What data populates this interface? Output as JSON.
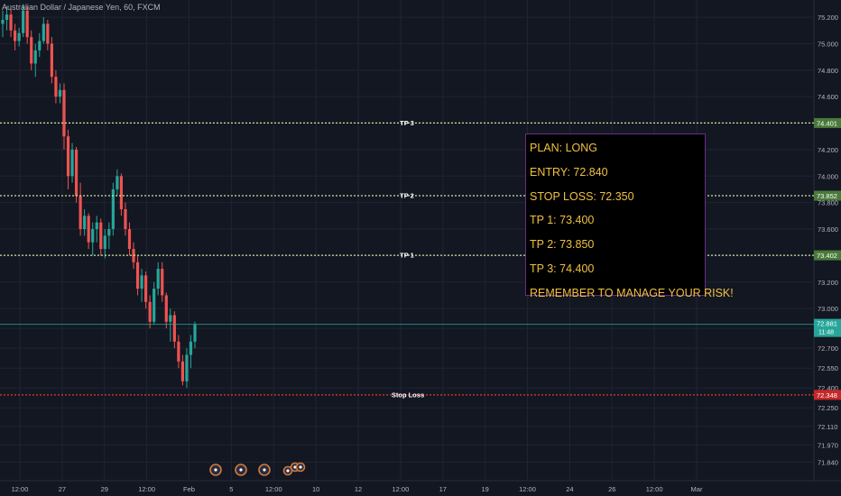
{
  "header": {
    "title": "Australian Dollar / Japanese Yen, 60, FXCM"
  },
  "colors": {
    "background": "#131722",
    "grid": "#1f2433",
    "axis_text": "#b2b5be",
    "candle_up": "#26a69a",
    "candle_down": "#ef5350",
    "tp_line": "#c8e6a0",
    "stop_line": "#e53935",
    "plan_text": "#f0c040",
    "plan_border": "#6a2c8a",
    "current_price": "#26a69a"
  },
  "plan": {
    "lines": [
      "PLAN: LONG",
      "ENTRY: 72.840",
      "STOP LOSS: 72.350",
      "TP 1: 73.400",
      "TP 2: 73.850",
      "TP 3: 74.400",
      "REMEMBER TO MANAGE YOUR RISK!"
    ]
  },
  "chart_data": {
    "type": "candlestick",
    "title": "Australian Dollar / Japanese Yen, 60, FXCM",
    "ylim": [
      71.7,
      75.33
    ],
    "y_ticks": [
      "71.840",
      "71.970",
      "72.110",
      "72.250",
      "72.400",
      "72.550",
      "72.700",
      "72.850",
      "73.000",
      "73.200",
      "73.400",
      "73.600",
      "73.800",
      "74.000",
      "74.200",
      "74.400",
      "74.600",
      "74.800",
      "75.000",
      "75.200"
    ],
    "x_ticks": [
      "12:00",
      "27",
      "29",
      "12:00",
      "Feb",
      "5",
      "12:00",
      "10",
      "12",
      "12:00",
      "17",
      "19",
      "12:00",
      "24",
      "26",
      "12:00",
      "Mar"
    ],
    "levels": [
      {
        "label": "TP 3",
        "value": 74.401,
        "tag": "74.401",
        "kind": "tp"
      },
      {
        "label": "TP 2",
        "value": 73.852,
        "tag": "73.852",
        "kind": "tp"
      },
      {
        "label": "TP 1",
        "value": 73.402,
        "tag": "73.402",
        "kind": "tp"
      },
      {
        "label": "Stop Loss",
        "value": 72.348,
        "tag": "72.348",
        "kind": "stop"
      }
    ],
    "current_price": {
      "value": 72.881,
      "tag": "72.881",
      "countdown": "11:48"
    },
    "events_count": 6,
    "candles": [
      [
        75.15,
        75.25,
        75.05,
        75.18
      ],
      [
        75.18,
        75.28,
        75.1,
        75.22
      ],
      [
        75.22,
        75.26,
        75.05,
        75.1
      ],
      [
        75.1,
        75.15,
        74.95,
        75.02
      ],
      [
        75.02,
        75.12,
        74.98,
        75.08
      ],
      [
        75.08,
        75.3,
        75.05,
        75.25
      ],
      [
        75.25,
        75.28,
        75.0,
        75.05
      ],
      [
        75.05,
        75.1,
        74.8,
        74.85
      ],
      [
        74.85,
        75.0,
        74.75,
        74.95
      ],
      [
        74.95,
        75.08,
        74.9,
        75.02
      ],
      [
        75.02,
        75.2,
        75.0,
        75.15
      ],
      [
        75.15,
        75.18,
        74.95,
        75.0
      ],
      [
        75.0,
        75.05,
        74.7,
        74.75
      ],
      [
        74.75,
        74.8,
        74.55,
        74.6
      ],
      [
        74.6,
        74.7,
        74.55,
        74.65
      ],
      [
        74.65,
        74.7,
        74.2,
        74.3
      ],
      [
        74.3,
        74.35,
        73.9,
        74.0
      ],
      [
        74.0,
        74.25,
        73.95,
        74.2
      ],
      [
        74.2,
        74.22,
        73.8,
        73.85
      ],
      [
        73.85,
        73.95,
        73.55,
        73.6
      ],
      [
        73.6,
        73.75,
        73.55,
        73.7
      ],
      [
        73.7,
        73.72,
        73.45,
        73.5
      ],
      [
        73.5,
        73.65,
        73.4,
        73.6
      ],
      [
        73.6,
        73.7,
        73.5,
        73.65
      ],
      [
        73.65,
        73.68,
        73.4,
        73.45
      ],
      [
        73.45,
        73.6,
        73.38,
        73.55
      ],
      [
        73.55,
        73.65,
        73.45,
        73.6
      ],
      [
        73.6,
        73.95,
        73.55,
        73.9
      ],
      [
        73.9,
        74.05,
        73.85,
        74.0
      ],
      [
        74.0,
        74.02,
        73.7,
        73.75
      ],
      [
        73.75,
        73.8,
        73.55,
        73.6
      ],
      [
        73.6,
        73.65,
        73.4,
        73.45
      ],
      [
        73.45,
        73.5,
        73.3,
        73.35
      ],
      [
        73.35,
        73.4,
        73.1,
        73.15
      ],
      [
        73.15,
        73.3,
        73.05,
        73.25
      ],
      [
        73.25,
        73.28,
        73.0,
        73.05
      ],
      [
        73.05,
        73.1,
        72.85,
        72.9
      ],
      [
        72.9,
        73.2,
        72.88,
        73.15
      ],
      [
        73.15,
        73.35,
        73.1,
        73.3
      ],
      [
        73.3,
        73.35,
        73.05,
        73.1
      ],
      [
        73.1,
        73.12,
        72.85,
        72.9
      ],
      [
        72.9,
        73.0,
        72.75,
        72.95
      ],
      [
        72.95,
        72.98,
        72.7,
        72.75
      ],
      [
        72.75,
        72.8,
        72.55,
        72.6
      ],
      [
        72.6,
        72.65,
        72.42,
        72.45
      ],
      [
        72.45,
        72.7,
        72.4,
        72.65
      ],
      [
        72.65,
        72.8,
        72.55,
        72.75
      ],
      [
        72.75,
        72.9,
        72.7,
        72.88
      ]
    ]
  }
}
